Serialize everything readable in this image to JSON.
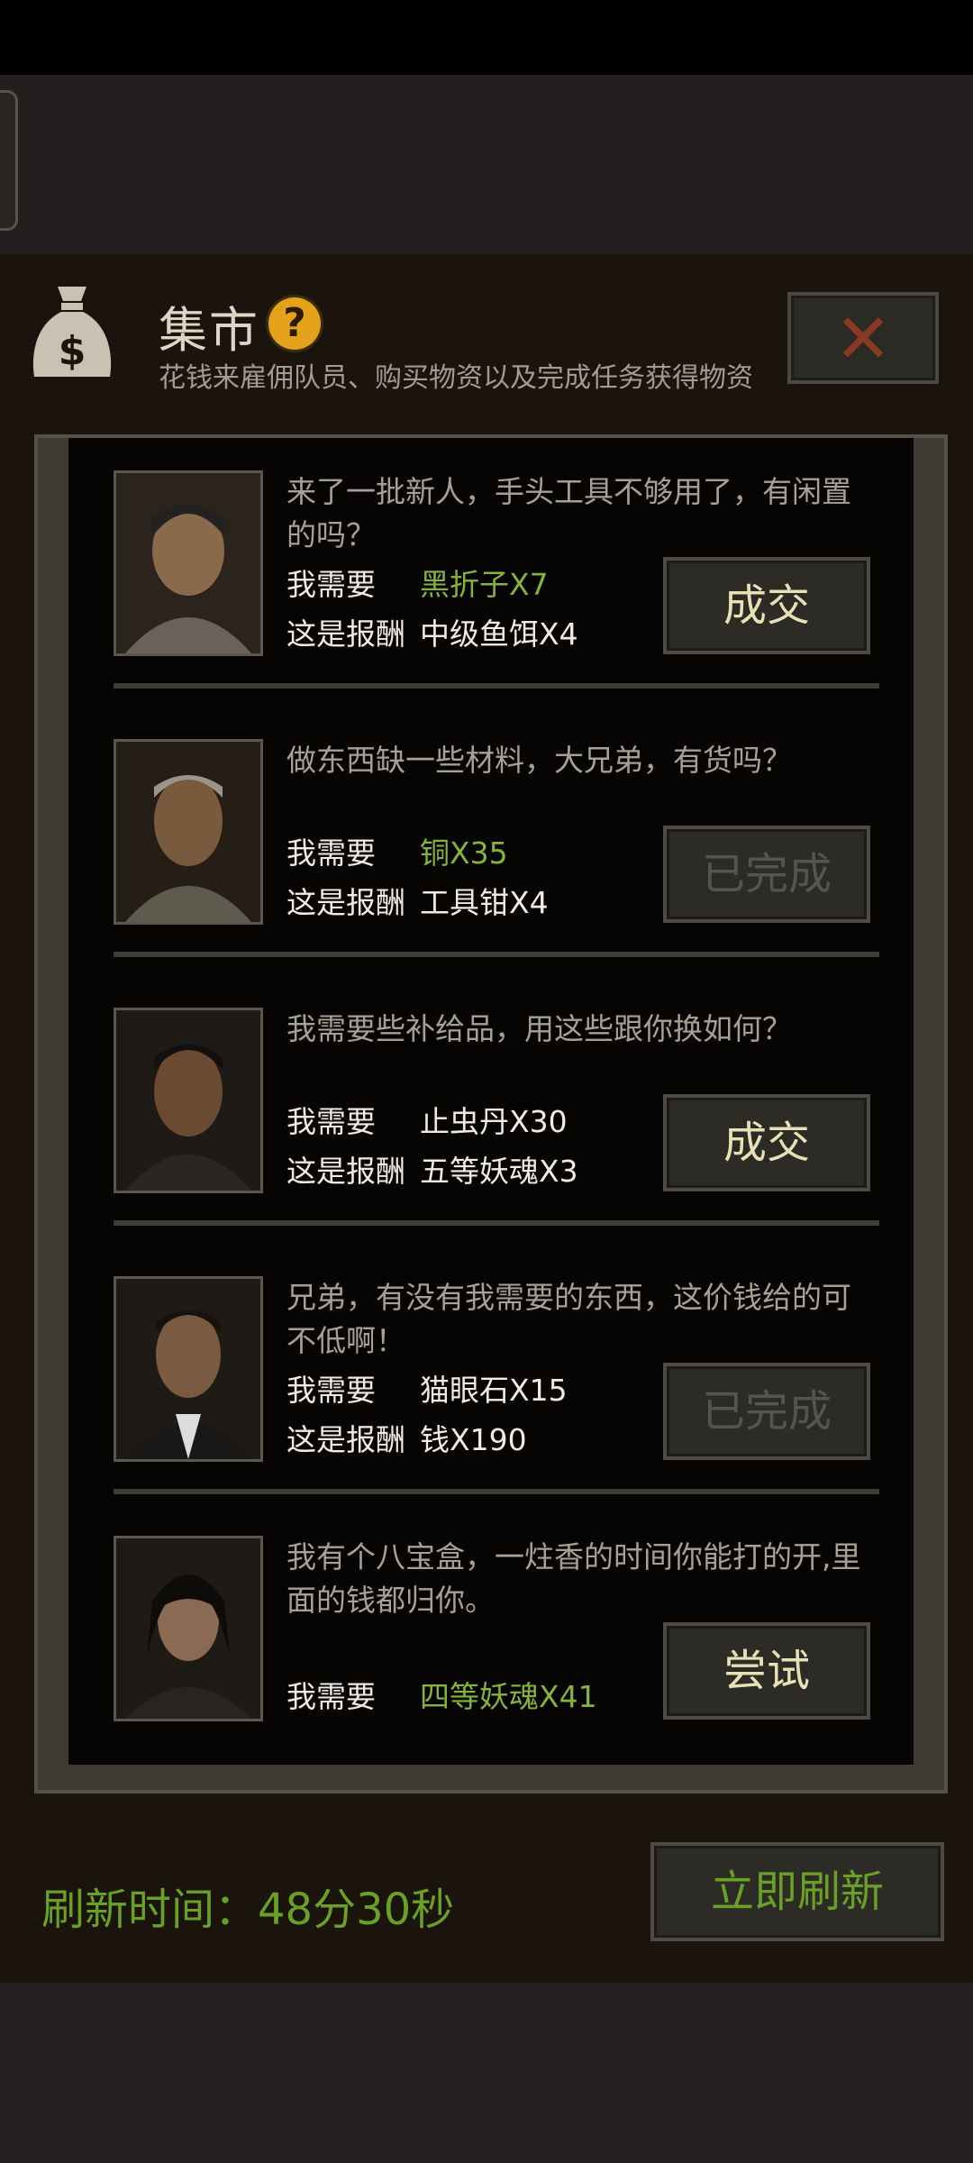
{
  "header": {
    "title": "集市",
    "subtitle": "花钱来雇佣队员、购买物资以及完成任务获得物资",
    "help_glyph": "?",
    "close_glyph": "✕"
  },
  "labels": {
    "need": "我需要",
    "reward": "这是报酬"
  },
  "requests": [
    {
      "message": "来了一批新人，手头工具不够用了，有闲置的吗？",
      "need": "黑折子X7",
      "need_color": "green",
      "reward": "中级鱼饵X4",
      "action": "成交",
      "action_state": "active"
    },
    {
      "message": "做东西缺一些材料，大兄弟，有货吗？",
      "need": "铜X35",
      "need_color": "green",
      "reward": "工具钳X4",
      "action": "已完成",
      "action_state": "done"
    },
    {
      "message": "我需要些补给品，用这些跟你换如何？",
      "need": "止虫丹X30",
      "need_color": "white",
      "reward": "五等妖魂X3",
      "action": "成交",
      "action_state": "active"
    },
    {
      "message": "兄弟，有没有我需要的东西，这价钱给的可不低啊！",
      "need": "猫眼石X15",
      "need_color": "white",
      "reward": "钱X190",
      "action": "已完成",
      "action_state": "done"
    },
    {
      "message": "我有个八宝盒，一炷香的时间你能打的开,里面的钱都归你。",
      "need": "四等妖魂X41",
      "need_color": "green",
      "reward": "",
      "action": "尝试",
      "action_state": "active"
    }
  ],
  "footer": {
    "refresh_time": "刷新时间：48分30秒",
    "refresh_button": "立即刷新"
  },
  "colors": {
    "green": "#84b43a",
    "refresh_green": "#6aa026",
    "help_yellow": "#e3a21a",
    "close_red": "#8a3a24"
  }
}
